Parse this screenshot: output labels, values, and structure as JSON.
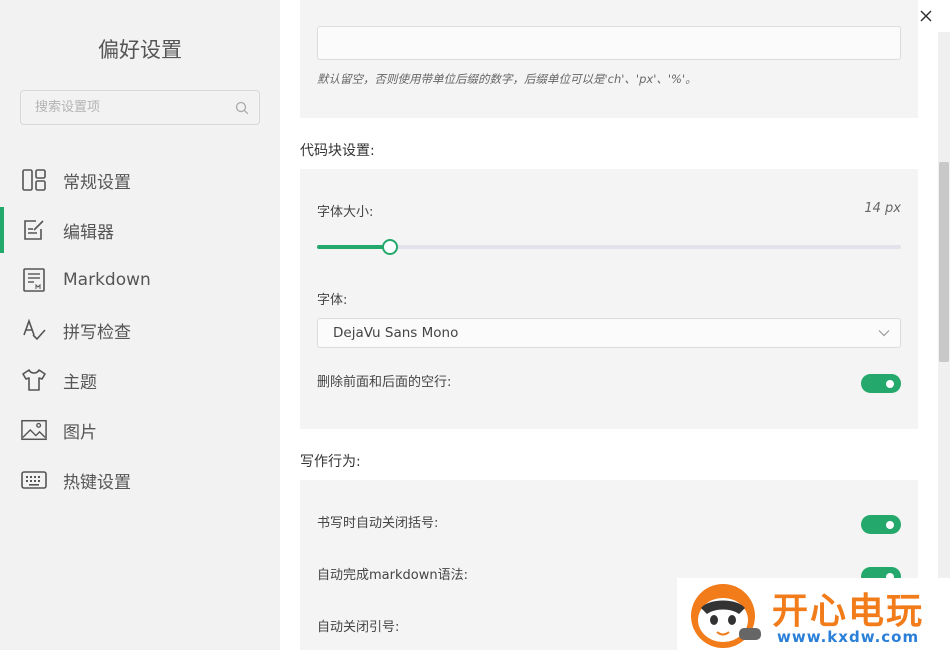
{
  "sidebar": {
    "title": "偏好设置",
    "search_placeholder": "搜索设置项",
    "items": [
      {
        "label": "常规设置",
        "icon": "general-icon"
      },
      {
        "label": "编辑器",
        "icon": "editor-icon",
        "active": true
      },
      {
        "label": "Markdown",
        "icon": "markdown-icon"
      },
      {
        "label": "拼写检查",
        "icon": "spellcheck-icon"
      },
      {
        "label": "主题",
        "icon": "theme-icon"
      },
      {
        "label": "图片",
        "icon": "image-icon"
      },
      {
        "label": "热键设置",
        "icon": "keyboard-icon"
      }
    ]
  },
  "main": {
    "width_hint": "默认留空，否则使用带单位后缀的数字，后缀单位可以是'ch'、'px'、'%'。",
    "code_block": {
      "title": "代码块设置:",
      "font_size_label": "字体大小:",
      "font_size_value": "14 px",
      "font_size_level": 0.125,
      "font_label": "字体:",
      "font_value": "DejaVu Sans Mono",
      "trim_label": "删除前面和后面的空行:",
      "trim_on": true
    },
    "writing": {
      "title": "写作行为:",
      "auto_bracket_label": "书写时自动关闭括号:",
      "auto_bracket_on": true,
      "auto_markdown_label": "自动完成markdown语法:",
      "auto_markdown_on": true,
      "auto_quote_label": "自动关闭引号:"
    }
  },
  "colors": {
    "accent": "#25a86b",
    "sidebar_bg": "#f2f2f2",
    "panel_bg": "#f4f4f4"
  },
  "watermark": {
    "text": "开心电玩",
    "url": "www.kxdw.com"
  }
}
